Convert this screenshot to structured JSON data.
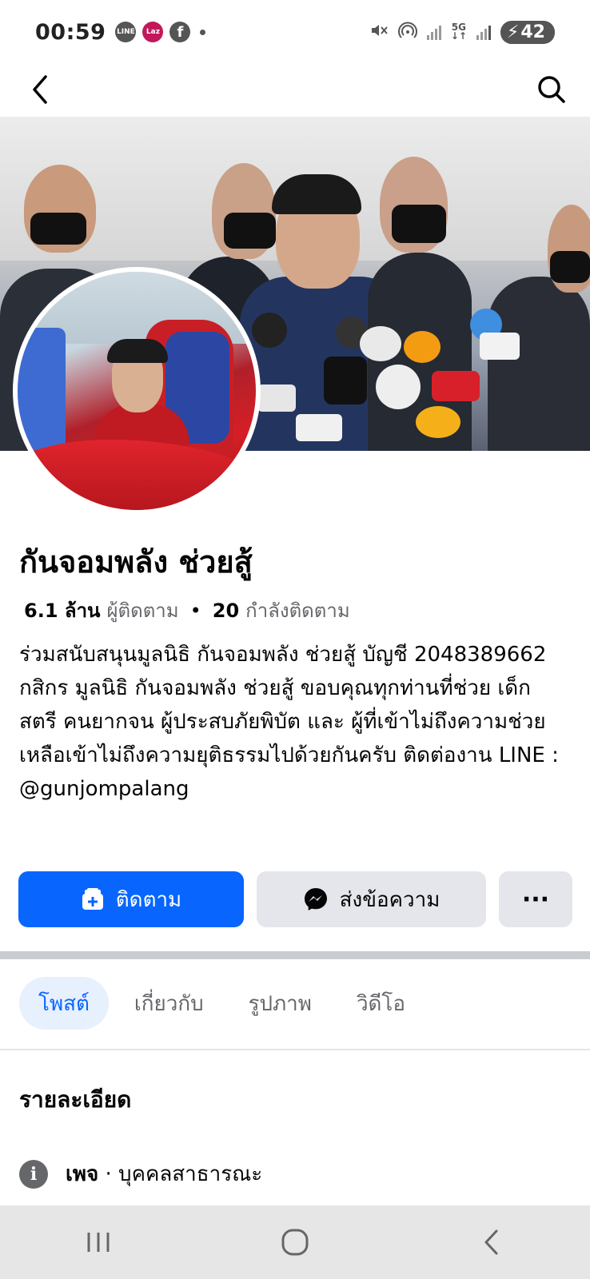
{
  "status_bar": {
    "time": "00:59",
    "notifications": [
      "line-icon",
      "lazada-icon",
      "facebook-icon"
    ],
    "line_label": "LINE",
    "laz_label": "Laz",
    "network": "5G",
    "battery": "42"
  },
  "header": {
    "back_icon": "chevron-left-icon",
    "search_icon": "search-icon"
  },
  "profile": {
    "name": "กันจอมพลัง ช่วยสู้",
    "followers_count": "6.1 ล้าน",
    "followers_label": "ผู้ติดตาม",
    "separator": "•",
    "following_count": "20",
    "following_label": "กำลังติดตาม",
    "bio": "ร่วมสนับสนุนมูลนิธิ กันจอมพลัง ช่วยสู้ บัญชี 2048389662 กสิกร มูลนิธิ กันจอมพลัง ช่วยสู้ ขอบคุณทุกท่านที่ช่วย เด็ก สตรี คนยากจน ผู้ประสบภัยพิบัต และ ผู้ที่เข้าไม่ถึงความช่วยเหลือเข้าไม่ถึงความยุติธรรมไปด้วยกันครับ ติดต่องาน LINE : @gunjompalang"
  },
  "actions": {
    "follow_label": "ติดตาม",
    "message_label": "ส่งข้อความ",
    "more_label": "···"
  },
  "tabs": [
    {
      "label": "โพสต์",
      "active": true
    },
    {
      "label": "เกี่ยวกับ",
      "active": false
    },
    {
      "label": "รูปภาพ",
      "active": false
    },
    {
      "label": "วิดีโอ",
      "active": false
    }
  ],
  "details": {
    "title": "รายละเอียด",
    "info_icon_label": "i",
    "category_label": "เพจ",
    "category_value": "· บุคคลสาธารณะ"
  },
  "colors": {
    "accent": "#0866ff",
    "tab_active_bg": "#e7f0fd",
    "secondary_button": "#e4e6eb"
  }
}
